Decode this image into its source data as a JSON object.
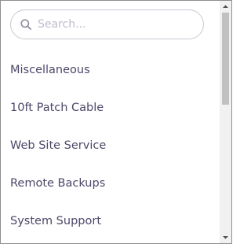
{
  "search": {
    "placeholder": "Search...",
    "value": "",
    "icon": "search-icon"
  },
  "items": [
    {
      "label": "Miscellaneous"
    },
    {
      "label": "10ft Patch Cable"
    },
    {
      "label": "Web Site Service"
    },
    {
      "label": "Remote Backups"
    },
    {
      "label": "System Support"
    }
  ],
  "colors": {
    "text": "#4b4869",
    "border": "#c9c9d3",
    "placeholder": "#bdbccb",
    "scrollbar_track": "#f1f1f1",
    "scrollbar_thumb": "#c1c1c1"
  }
}
